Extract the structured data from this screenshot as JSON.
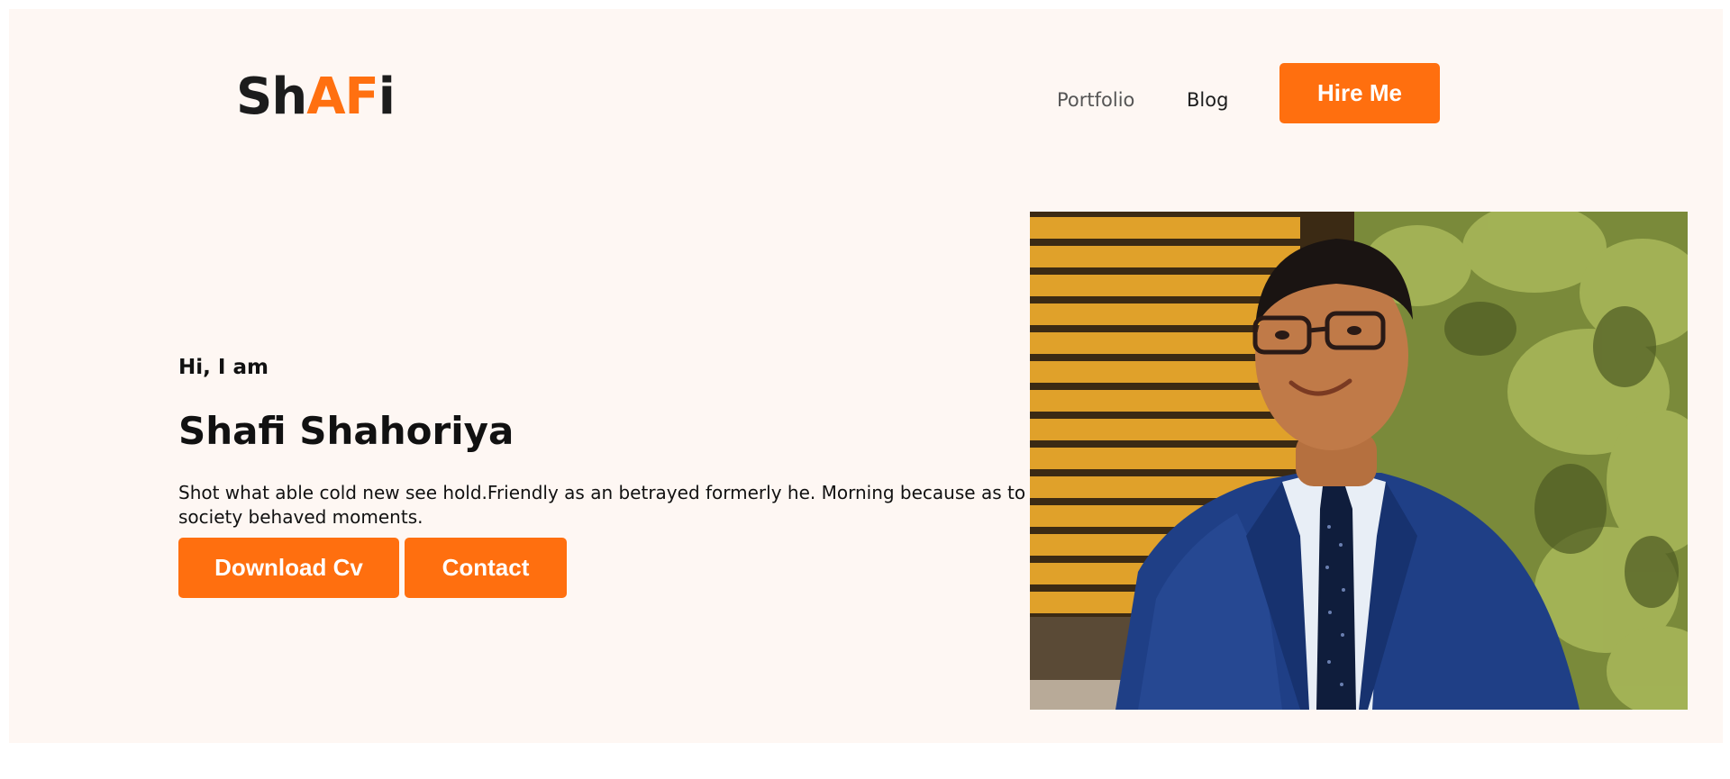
{
  "header": {
    "logo": {
      "part1": "Sh",
      "part2": "AF",
      "part3": "i"
    },
    "nav": {
      "portfolio": "Portfolio",
      "blog": "Blog"
    },
    "hire_button": "Hire Me"
  },
  "hero": {
    "greeting": "Hi, I am",
    "name": "Shafi Shahoriya",
    "description": "Shot what able cold new see hold.Friendly as an betrayed formerly he. Morning because as to society behaved moments.",
    "download_button": "Download Cv",
    "contact_button": "Contact"
  },
  "colors": {
    "accent": "#ff6f0f",
    "background": "#fef7f3",
    "text": "#111111"
  }
}
